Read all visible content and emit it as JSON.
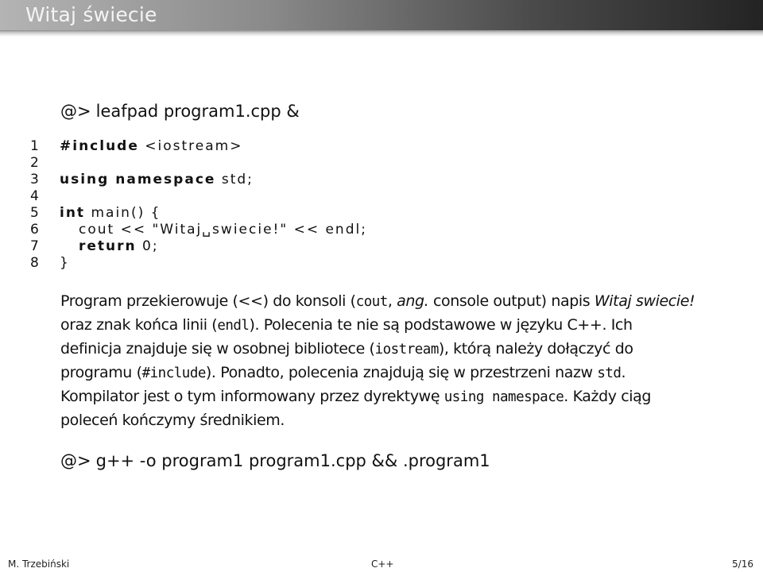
{
  "slide": {
    "title": "Witaj świecie"
  },
  "command1": {
    "prompt": "@>",
    "text": "leafpad program1.cpp &"
  },
  "code": [
    {
      "n": "1",
      "kw": "#include",
      "rest": " <iostream>",
      "indent": false
    },
    {
      "n": "2",
      "kw": "",
      "rest": "",
      "indent": false
    },
    {
      "n": "3",
      "kw": "using namespace",
      "rest": " std;",
      "indent": false
    },
    {
      "n": "4",
      "kw": "",
      "rest": "",
      "indent": false
    },
    {
      "n": "5",
      "kw": "int",
      "rest": " main() {",
      "indent": false
    },
    {
      "n": "6",
      "kw": "",
      "rest": "cout << \"Witaj␣swiecie!\" << endl;",
      "indent": true
    },
    {
      "n": "7",
      "kw": "return",
      "rest": " 0;",
      "indent": true
    },
    {
      "n": "8",
      "kw": "",
      "rest": "}",
      "indent": false
    }
  ],
  "paragraph": [
    {
      "t": "Program przekierowuje (<<) do konsoli (",
      "s": "n"
    },
    {
      "t": "cout",
      "s": "tt"
    },
    {
      "t": ", ",
      "s": "n"
    },
    {
      "t": "ang.",
      "s": "it"
    },
    {
      "t": " console output) napis ",
      "s": "n"
    },
    {
      "t": "Witaj swiecie!",
      "s": "it"
    },
    {
      "t": " oraz znak końca linii (",
      "s": "n"
    },
    {
      "t": "endl",
      "s": "tt"
    },
    {
      "t": "). Polecenia te nie są podstawowe w języku C++. Ich definicja znajduje się w osobnej bibliotece (",
      "s": "n"
    },
    {
      "t": "iostream",
      "s": "tt"
    },
    {
      "t": "), którą należy dołączyć do programu (",
      "s": "n"
    },
    {
      "t": "#include",
      "s": "tt"
    },
    {
      "t": "). Ponadto, polecenia znajdują się w przestrzeni nazw ",
      "s": "n"
    },
    {
      "t": "std",
      "s": "tt"
    },
    {
      "t": ". Kompilator jest o tym informowany przez dyrektywę ",
      "s": "n"
    },
    {
      "t": "using namespace",
      "s": "tt"
    },
    {
      "t": ". Każdy ciąg poleceń kończymy średnikiem.",
      "s": "n"
    }
  ],
  "command2": {
    "prompt": "@>",
    "text": "g++ -o program1 program1.cpp && .program1"
  },
  "footer": {
    "author": "M. Trzebiński",
    "topic": "C++",
    "page": "5/16"
  }
}
